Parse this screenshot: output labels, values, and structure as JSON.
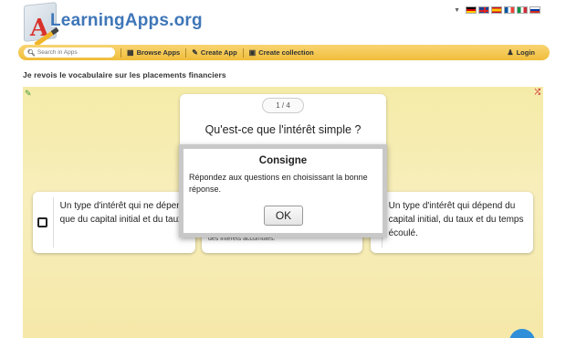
{
  "header": {
    "logo_text": "LearningApps.org",
    "logo_letter": "A",
    "languages": [
      "de",
      "en",
      "es",
      "fr",
      "it",
      "ru"
    ]
  },
  "navbar": {
    "search_placeholder": "Search in Apps",
    "browse_label": "Browse Apps",
    "create_label": "Create App",
    "collection_label": "Create collection",
    "login_label": "Login"
  },
  "page": {
    "title": "Je revois le vocabulaire sur les placements financiers"
  },
  "quiz": {
    "counter": "1 / 4",
    "question": "Qu'est-ce que l'intérêt simple ?",
    "answers": [
      {
        "text": "Un type d'intérêt qui ne dépend que du capital initial et du taux."
      },
      {
        "text": "des intérêts accumulés."
      },
      {
        "text": "Un type d'intérêt qui dépend du capital initial, du taux et du temps écoulé."
      }
    ]
  },
  "modal": {
    "title": "Consigne",
    "text": "Répondez aux questions en choisissant la bonne réponse.",
    "ok_label": "OK"
  },
  "colors": {
    "navbar": "#f0bd3a",
    "logo_text": "#3e76b8",
    "app_background": "#f6ebb0",
    "fab": "#2f8fd8"
  }
}
